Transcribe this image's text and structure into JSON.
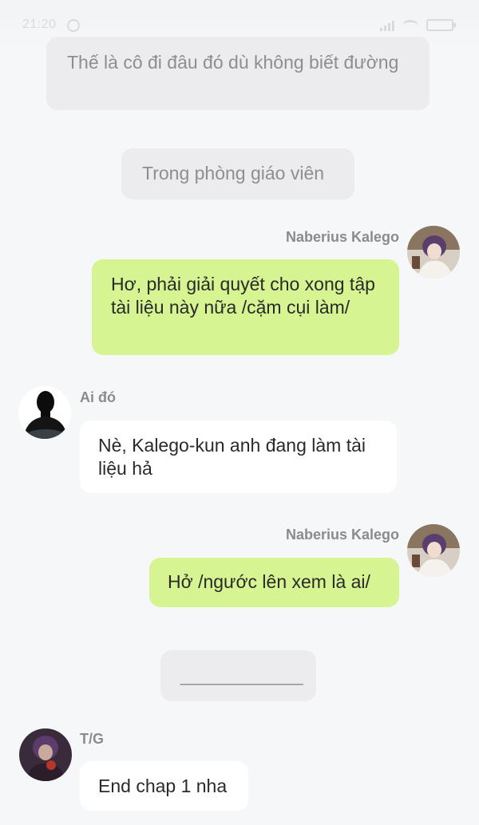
{
  "status_bar": {
    "time": "21:20",
    "alarm_icon": "alarm-icon",
    "signal_icon": "signal-icon",
    "wifi_icon": "wifi-icon",
    "battery_icon": "battery-icon"
  },
  "messages": [
    {
      "type": "narration",
      "text": "Thế là cô đi đâu đó dù không biết đường"
    },
    {
      "type": "narration",
      "text": "Trong phòng giáo viên"
    },
    {
      "type": "outgoing",
      "sender": "Naberius Kalego",
      "text": "Hơ, phải giải quyết cho xong tập tài liệu này nữa /cặm cụi làm/",
      "avatar": "kalego-avatar"
    },
    {
      "type": "incoming",
      "sender": "Ai đó",
      "text": "Nè, Kalego-kun anh đang làm tài liệu hả",
      "avatar": "silhouette-avatar"
    },
    {
      "type": "outgoing",
      "sender": "Naberius Kalego",
      "text": "Hở /ngước lên xem là ai/",
      "avatar": "kalego-avatar"
    },
    {
      "type": "narration",
      "text": "____________"
    },
    {
      "type": "incoming",
      "sender": "T/G",
      "text": "End chap 1 nha",
      "avatar": "author-avatar"
    }
  ],
  "colors": {
    "background": "#f6f7f9",
    "narration_bubble": "#ececee",
    "outgoing_bubble": "#d6f491",
    "incoming_bubble": "#ffffff"
  }
}
